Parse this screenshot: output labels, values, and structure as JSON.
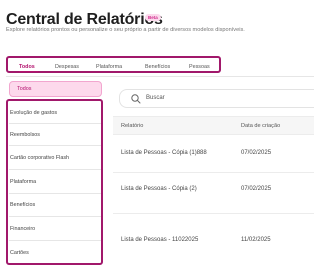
{
  "header": {
    "title": "Central de Relatórios",
    "badge": "Beta",
    "subtitle": "Explore relatórios prontos ou personalize o seu próprio a partir de diversos modelos disponíveis."
  },
  "tabs": [
    {
      "label": "Todos",
      "active": true
    },
    {
      "label": "Despesas"
    },
    {
      "label": "Plataforma"
    },
    {
      "label": "Benefícios"
    },
    {
      "label": "Pessoas"
    }
  ],
  "sidebar": {
    "items": [
      {
        "label": "Todos",
        "active": true
      },
      {
        "label": "Evolução de gastos"
      },
      {
        "label": "Reembolsos"
      },
      {
        "label": "Cartão corporativo Flash"
      },
      {
        "label": "Plataforma"
      },
      {
        "label": "Benefícios"
      },
      {
        "label": "Financeiro"
      },
      {
        "label": "Cartões"
      }
    ]
  },
  "search": {
    "placeholder": "Buscar"
  },
  "table": {
    "columns": [
      "Relatório",
      "Data de criação"
    ],
    "rows": [
      {
        "name": "Lista de Pessoas - Cópia (1)888",
        "date": "07/02/2025"
      },
      {
        "name": "Lista de Pessoas - Cópia (2)",
        "date": "07/02/2025"
      },
      {
        "name": "Lista de Pessoas - 11022025",
        "date": "11/02/2025"
      }
    ]
  },
  "colors": {
    "accent": "#b3136e",
    "highlight_border": "#a1186b",
    "active_bg": "#fdd9ec"
  },
  "icons": {
    "search": "search-icon"
  }
}
